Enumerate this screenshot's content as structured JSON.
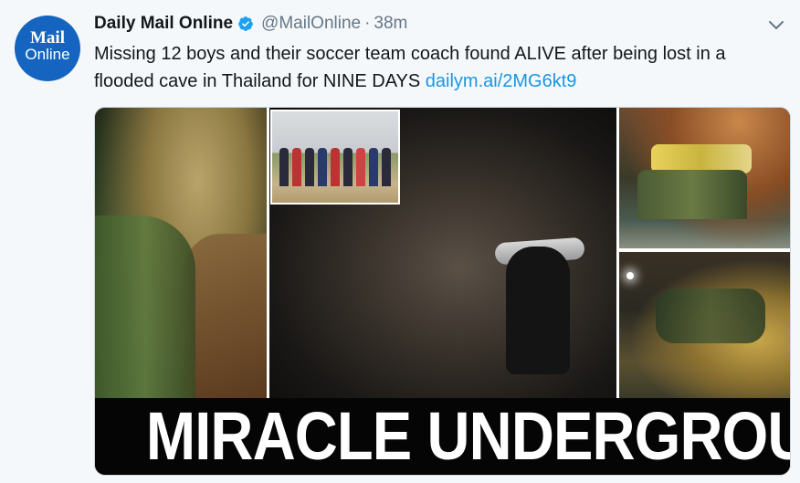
{
  "tweet": {
    "avatar": {
      "line1": "Mail",
      "line2": "Online",
      "bg_color": "#1565c0"
    },
    "display_name": "Daily Mail Online",
    "verified_icon": "verified-badge-icon",
    "handle": "@MailOnline",
    "separator": "·",
    "time": "38m",
    "text": "Missing 12 boys and their soccer team coach found ALIVE after being lost in a flooded cave in Thailand for NINE DAYS",
    "link_text": "dailym.ai/2MG6kt9",
    "menu_icon": "chevron-down-icon",
    "link_color": "#1b95e0"
  },
  "media": {
    "headline": "MIRACLE UNDERGROUND"
  }
}
